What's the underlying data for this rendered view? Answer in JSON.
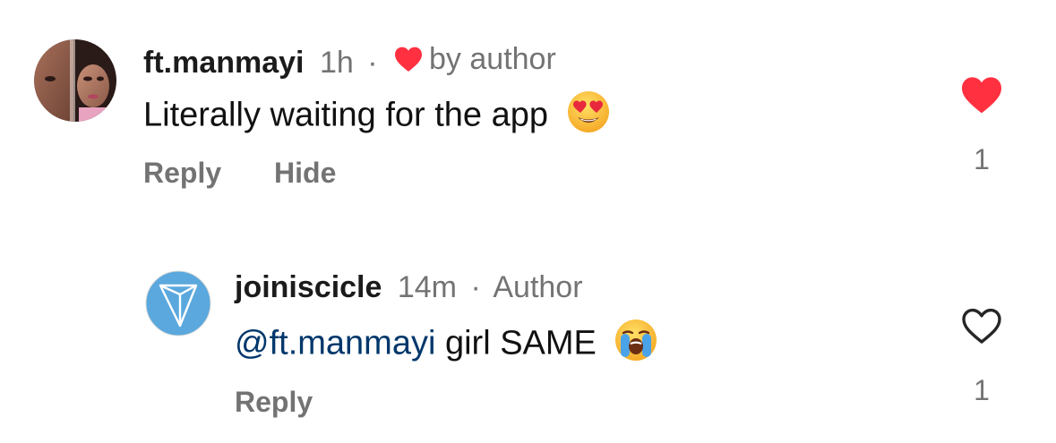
{
  "colors": {
    "like_red": "#ff3040",
    "muted_text": "#737373",
    "mention_blue": "#00376b",
    "avatar_blue": "#5aa8dd"
  },
  "comments": [
    {
      "username": "ft.manmayi",
      "time": "1h",
      "separator": "·",
      "liked_by_author_icon": "heart-filled-icon",
      "liked_by_author_label": "by author",
      "text": "Literally waiting for the app",
      "emoji": "heart-eyes-emoji",
      "actions": {
        "reply": "Reply",
        "hide": "Hide"
      },
      "liked": true,
      "like_icon": "heart-filled-icon",
      "like_count": "1"
    },
    {
      "username": "joiniscicle",
      "time": "14m",
      "separator": "·",
      "author_tag": "Author",
      "mention": "@ft.manmayi",
      "text": "girl SAME",
      "emoji": "loudly-crying-emoji",
      "actions": {
        "reply": "Reply"
      },
      "liked": false,
      "like_icon": "heart-outline-icon",
      "like_count": "1"
    }
  ]
}
